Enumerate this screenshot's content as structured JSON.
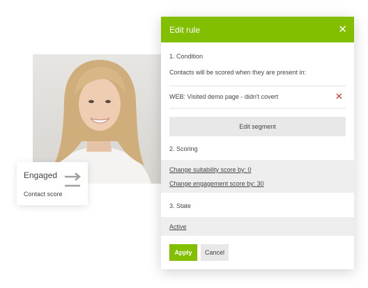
{
  "profile": {
    "photo_description_icon": "portrait-photo",
    "engaged_label": "Engaged",
    "contact_score_label": "Contact score",
    "arrow_icon": "arrow-right-icon"
  },
  "dialog": {
    "title": "Edit rule",
    "close_icon": "close-icon",
    "accent_color": "#82bf00",
    "condition": {
      "heading": "1. Condition",
      "description": "Contacts will be scored when they are present in:",
      "segment_item": "WEB: Visited demo page - didn't covert",
      "remove_icon": "remove-x-icon",
      "remove_color": "#d22d2d",
      "edit_segment_label": "Edit segment"
    },
    "scoring": {
      "heading": "2. Scoring",
      "suitability_link": "Change suitability score by: 0",
      "engagement_link": "Change engagement score by: 30"
    },
    "state": {
      "heading": "3. State",
      "value_link": "Active"
    },
    "buttons": {
      "apply": "Apply",
      "cancel": "Cancel"
    }
  }
}
